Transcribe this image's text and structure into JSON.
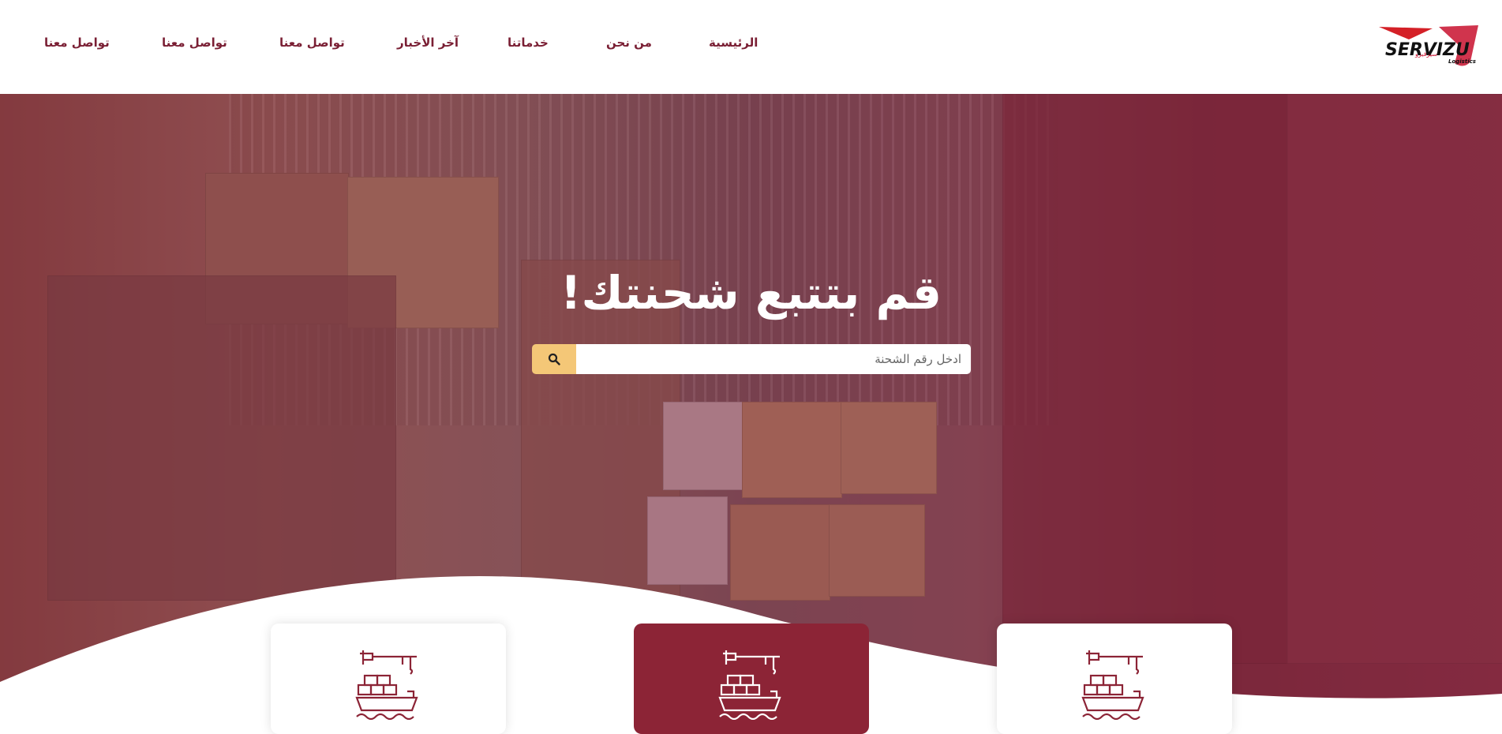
{
  "brand": {
    "logo_text": "SERVIZU",
    "logo_sub": "Logistics",
    "logo_arabic": "سيرفيزو",
    "colors": {
      "primary": "#7a1f34",
      "accent": "#f4c777",
      "card_highlight": "#8c2436"
    }
  },
  "nav": {
    "items": [
      {
        "label": "الرئيسية"
      },
      {
        "label": "من نحن"
      },
      {
        "label": "خدماتنا"
      },
      {
        "label": "آخر الأخبار"
      },
      {
        "label": "تواصل معنا"
      },
      {
        "label": "تواصل معنا"
      },
      {
        "label": "تواصل معنا"
      }
    ]
  },
  "hero": {
    "title": "قم بتتبع شحنتك!",
    "search": {
      "placeholder": "ادخل رقم الشحنة",
      "button_icon": "search-icon"
    }
  },
  "services": {
    "cards": [
      {
        "icon": "cargo-ship-icon",
        "highlighted": false
      },
      {
        "icon": "cargo-ship-icon",
        "highlighted": true
      },
      {
        "icon": "cargo-ship-icon",
        "highlighted": false
      }
    ]
  }
}
